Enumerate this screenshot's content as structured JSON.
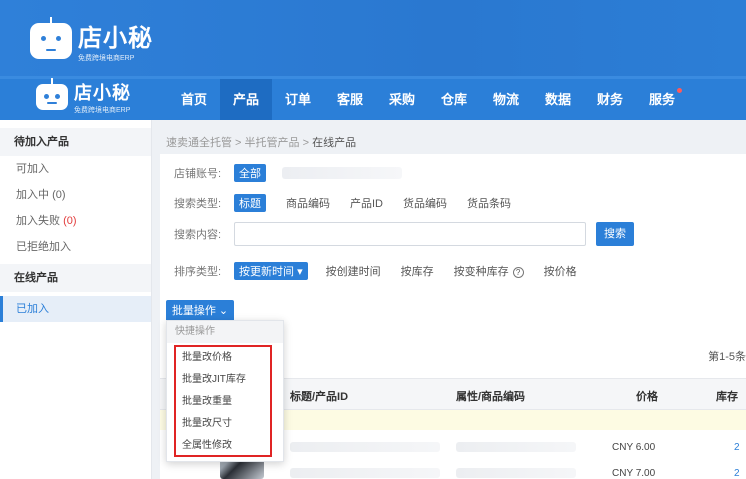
{
  "brand": {
    "name": "店小秘",
    "tagline": "免费跨境电商ERP"
  },
  "nav": {
    "items": [
      {
        "label": "首页",
        "active": false
      },
      {
        "label": "产品",
        "active": true
      },
      {
        "label": "订单",
        "active": false
      },
      {
        "label": "客服",
        "active": false
      },
      {
        "label": "采购",
        "active": false
      },
      {
        "label": "仓库",
        "active": false
      },
      {
        "label": "物流",
        "active": false
      },
      {
        "label": "数据",
        "active": false
      },
      {
        "label": "财务",
        "active": false
      },
      {
        "label": "服务",
        "active": false,
        "dot": true
      }
    ]
  },
  "sidebar": {
    "group1": "待加入产品",
    "items1": [
      {
        "label": "可加入"
      },
      {
        "label": "加入中",
        "count": "(0)"
      },
      {
        "label": "加入失败",
        "count": "(0)"
      },
      {
        "label": "已拒绝加入"
      }
    ],
    "group2": "在线产品",
    "items2": [
      {
        "label": "已加入",
        "active": true
      }
    ]
  },
  "breadcrumb": {
    "path": "速卖通全托管 > 半托管产品 > ",
    "current": "在线产品"
  },
  "filters": {
    "shop_label": "店铺账号:",
    "shop_value": "全部",
    "search_type_label": "搜索类型:",
    "search_types": [
      "标题",
      "商品编码",
      "产品ID",
      "货品编码",
      "货品条码"
    ],
    "content_label": "搜索内容:",
    "search_button": "搜索",
    "sort_label": "排序类型:",
    "sort_selected": "按更新时间",
    "sort_options": [
      "按创建时间",
      "按库存",
      "按变种库存",
      "按价格"
    ]
  },
  "batch_button": "批量操作",
  "table": {
    "count_text": "第1-5条",
    "headers": [
      "标题/产品ID",
      "属性/商品编码",
      "价格",
      "库存"
    ],
    "rows": [
      {
        "price": "CNY 6.00",
        "stock": "2"
      },
      {
        "price": "CNY 7.00",
        "stock": "2"
      }
    ]
  },
  "dropdown": {
    "header": "快捷操作",
    "items": [
      "批量改价格",
      "批量改JIT库存",
      "批量改重量",
      "批量改尺寸",
      "全属性修改"
    ]
  },
  "colors": {
    "primary": "#2b7fd8",
    "highlight_border": "#e02424"
  }
}
